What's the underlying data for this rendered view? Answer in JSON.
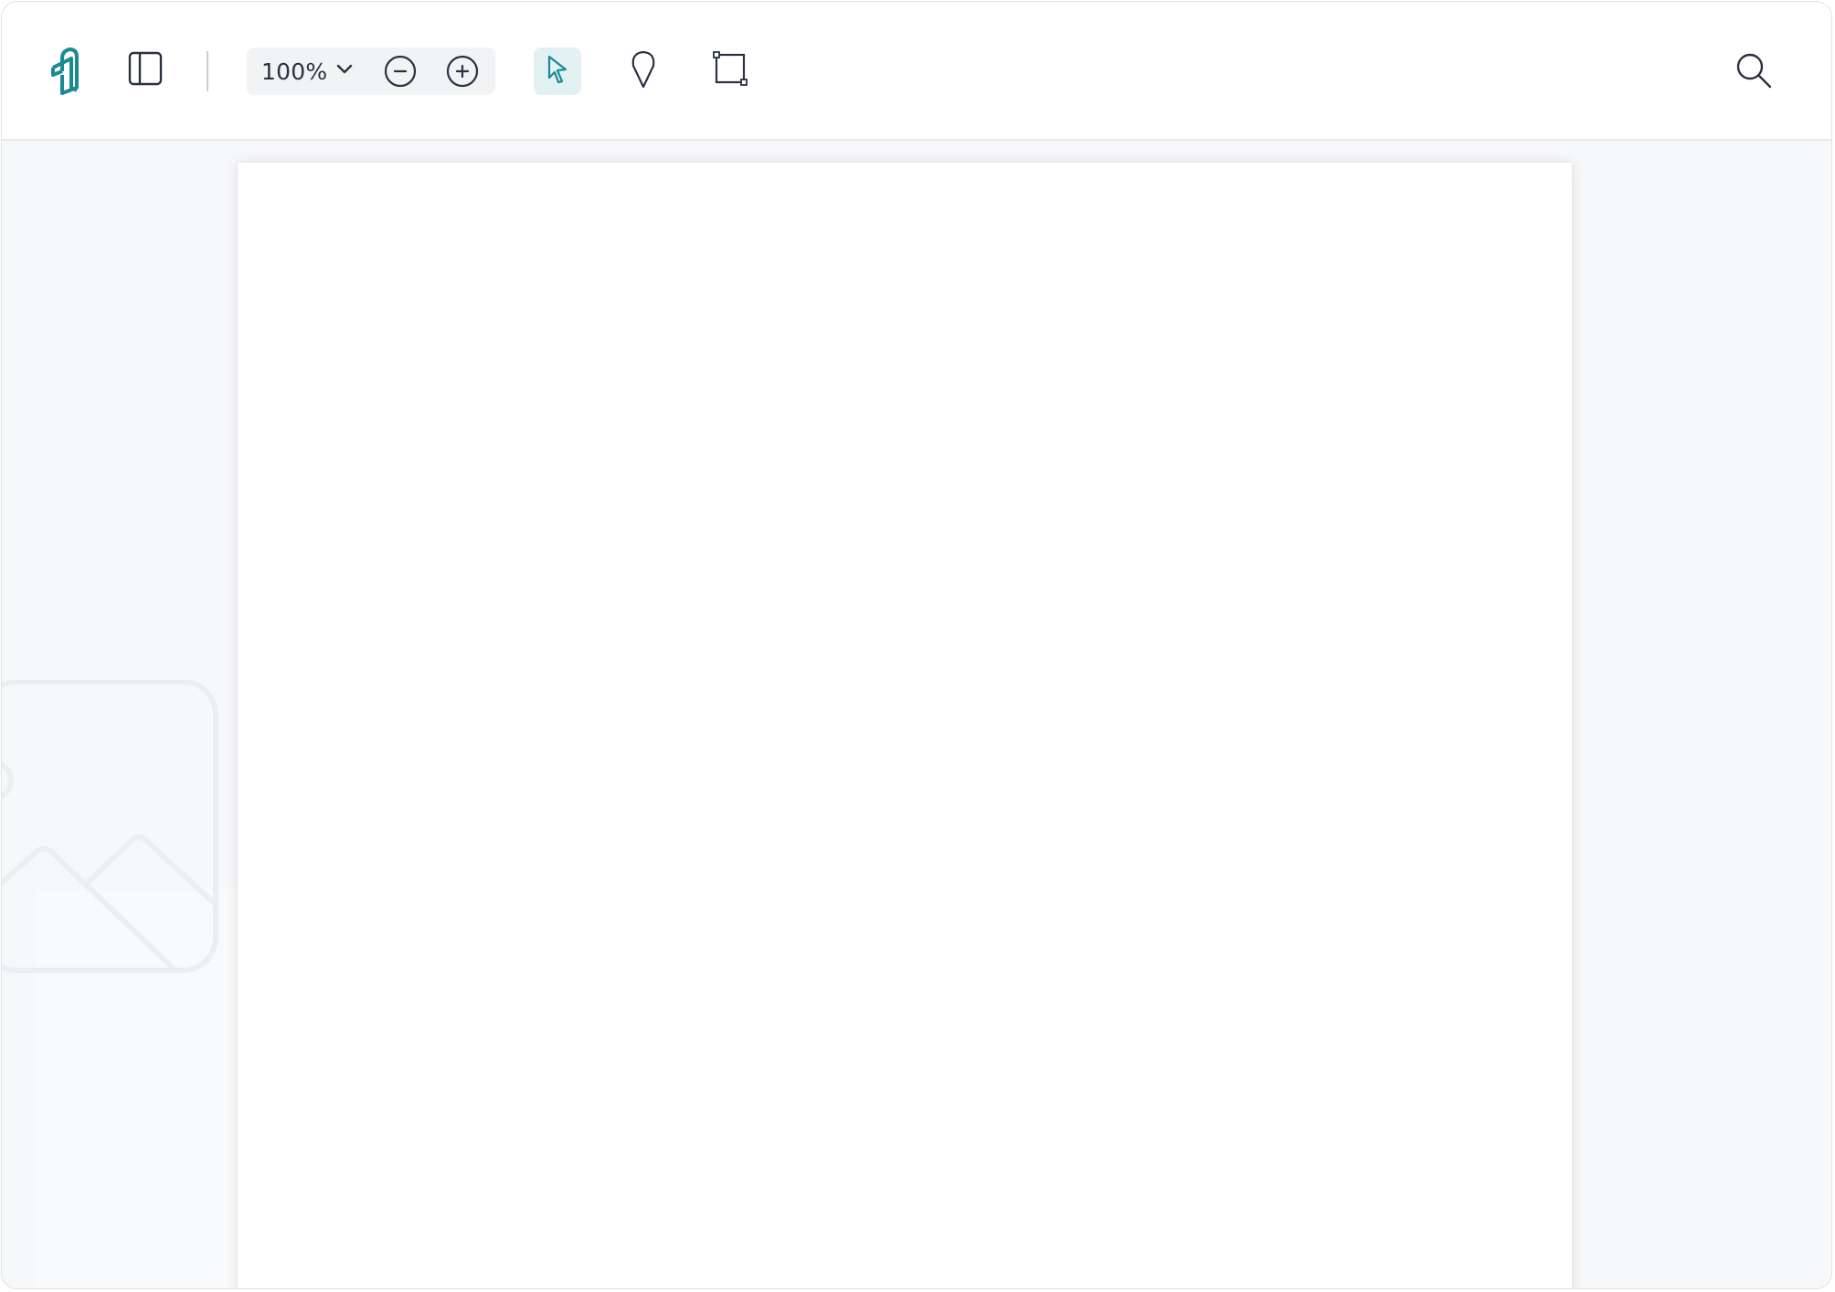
{
  "toolbar": {
    "logo": {
      "icon": "app-logo-icon",
      "color": "#1a8a95"
    },
    "sidebar_toggle": {
      "icon": "sidebar-panel-icon"
    },
    "zoom": {
      "value": "100%",
      "icon_dropdown": "chevron-down-icon",
      "icon_zoom_out": "zoom-out-icon",
      "icon_zoom_in": "zoom-in-icon"
    },
    "tools": [
      {
        "id": "select",
        "icon": "pointer-icon",
        "active": true
      },
      {
        "id": "pin",
        "icon": "map-pin-icon",
        "active": false
      },
      {
        "id": "crop",
        "icon": "crop-icon",
        "active": false
      }
    ],
    "search": {
      "icon": "search-icon"
    }
  },
  "canvas": {
    "background_placeholder_icon": "image-placeholder-icon"
  },
  "colors": {
    "accent": "#1a8a95",
    "active_tool_bg": "#e3f1f3",
    "icon": "#2a3140",
    "canvas_bg": "#f7f8fa"
  }
}
